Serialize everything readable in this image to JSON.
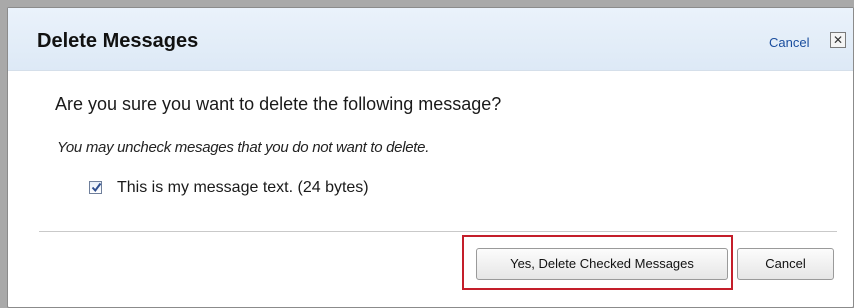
{
  "dialog": {
    "title": "Delete Messages",
    "cancel_link": "Cancel",
    "close_glyph": "✕",
    "question": "Are you sure you want to delete the following message?",
    "hint": "You may uncheck mesages that you do not want to delete.",
    "messages": [
      {
        "label": "This is my message text. (24 bytes)",
        "checked": true
      }
    ],
    "buttons": {
      "confirm": "Yes, Delete Checked Messages",
      "cancel": "Cancel"
    }
  },
  "colors": {
    "highlight": "#c41e2a",
    "link": "#1a4d9e"
  },
  "icons": {
    "close": "close-icon",
    "check": "checkmark-icon"
  }
}
